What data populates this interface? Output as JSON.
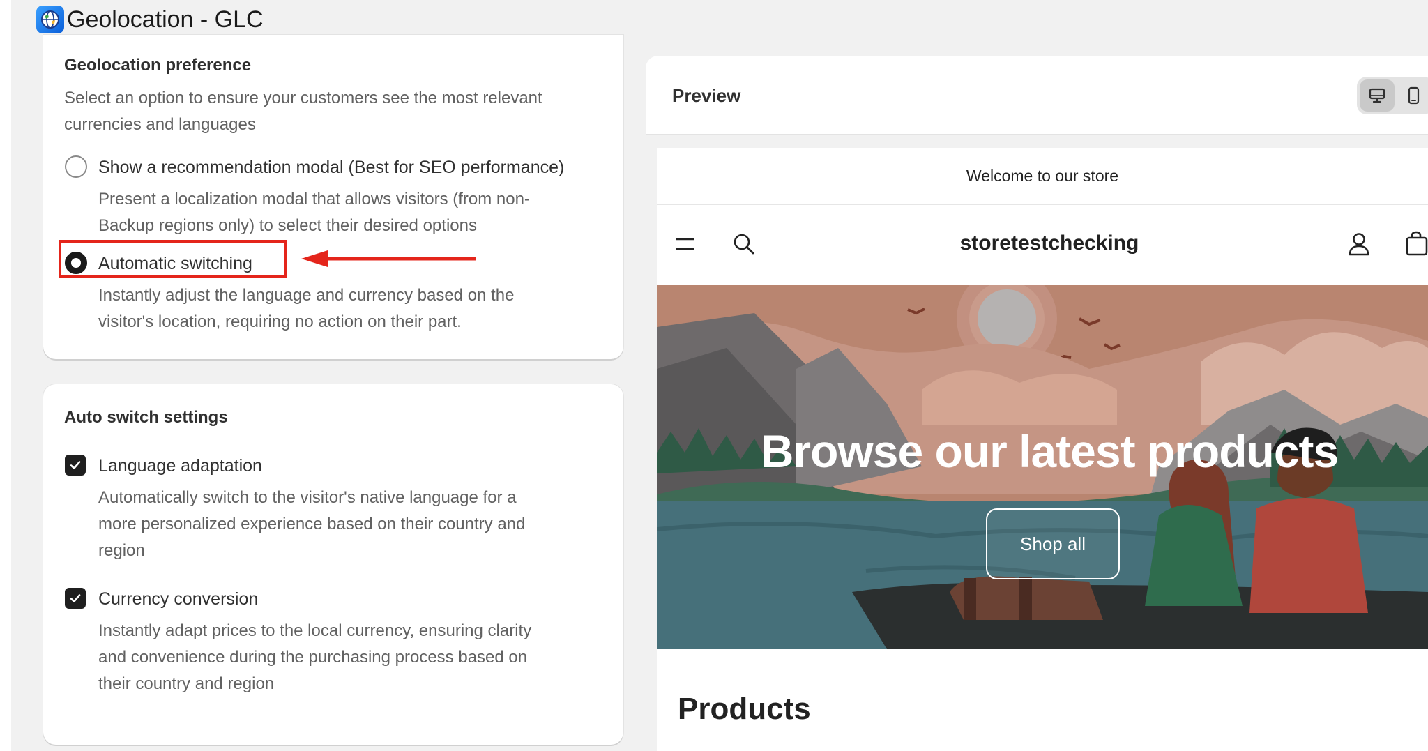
{
  "app": {
    "title": "Geolocation - GLC",
    "icon": "globe-icon"
  },
  "preference": {
    "title": "Geolocation preference",
    "description": "Select an option to ensure your customers see the most relevant currencies and languages",
    "description_lines": [
      "Select an option to ensure your customers see the most relevant",
      "currencies and languages"
    ],
    "options": [
      {
        "label": "Show a recommendation modal (Best for SEO performance)",
        "desc_lines": [
          "Present a localization modal that allows visitors (from non-",
          "Backup regions only) to select their desired options"
        ],
        "selected": false
      },
      {
        "label": "Automatic switching",
        "desc_lines": [
          "Instantly adjust the language and currency based on the",
          "visitor's location, requiring no action on their part."
        ],
        "selected": true
      }
    ]
  },
  "auto_switch": {
    "title": "Auto switch settings",
    "items": [
      {
        "label": "Language adaptation",
        "desc_lines": [
          "Automatically switch to the visitor's native language for a",
          "more personalized experience based on their country and",
          "region"
        ],
        "checked": true
      },
      {
        "label": "Currency conversion",
        "desc_lines": [
          "Instantly adapt prices to the local currency, ensuring clarity",
          "and convenience during the purchasing process based on",
          "their country and region"
        ],
        "checked": true
      }
    ]
  },
  "preview": {
    "title": "Preview",
    "devices": [
      "desktop-icon",
      "mobile-icon"
    ],
    "active_device": "desktop",
    "store": {
      "announcement": "Welcome to our store",
      "name": "storetestchecking",
      "hero_title": "Browse our latest products",
      "hero_button": "Shop all",
      "products_heading": "Products"
    }
  },
  "colors": {
    "highlight": "#e4251b",
    "accent_dark": "#1a1a1a"
  }
}
